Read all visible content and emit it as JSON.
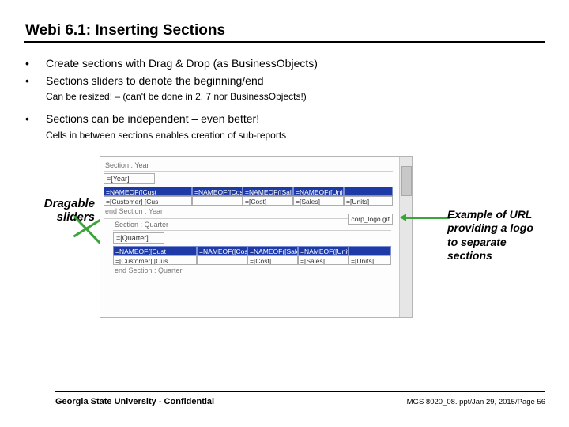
{
  "title": "Webi 6.1: Inserting Sections",
  "bullets": {
    "b1": "Create sections with Drag & Drop (as BusinessObjects)",
    "b2": "Sections sliders to denote the beginning/end",
    "b2_sub": "Can be resized! – (can't be done in 2. 7 nor BusinessObjects!)",
    "b3": "Sections can be independent – even better!",
    "b3_sub": "Cells in between sections enables creation of sub-reports"
  },
  "left_label_l1": "Dragable",
  "left_label_l2": "sliders",
  "right_label": "Example of URL providing a logo to separate sections",
  "shot": {
    "sectionYear": "Section : Year",
    "yearCell": "=[Year]",
    "endYear": "end Section : Year",
    "sectionQuarter": "Section : Quarter",
    "quarterCell": "=[Quarter]",
    "endQuarter": "end Section : Quarter",
    "logoCell": "corp_logo.gif",
    "hdr": {
      "c1": "=NAMEOF([Cust",
      "c2": "=NAMEOF([Cost",
      "c3": "=NAMEOF([Sale",
      "c4": "=NAMEOF([Units",
      "c5": ""
    },
    "row": {
      "c1": "=[Customer] [Cus",
      "c2": "",
      "c3": "=[Cost]",
      "c4": "=[Sales]",
      "c5": "=[Units]"
    }
  },
  "footer": {
    "left": "Georgia State University - Confidential",
    "right": "MGS 8020_08. ppt/Jan 29, 2015/Page 56"
  }
}
